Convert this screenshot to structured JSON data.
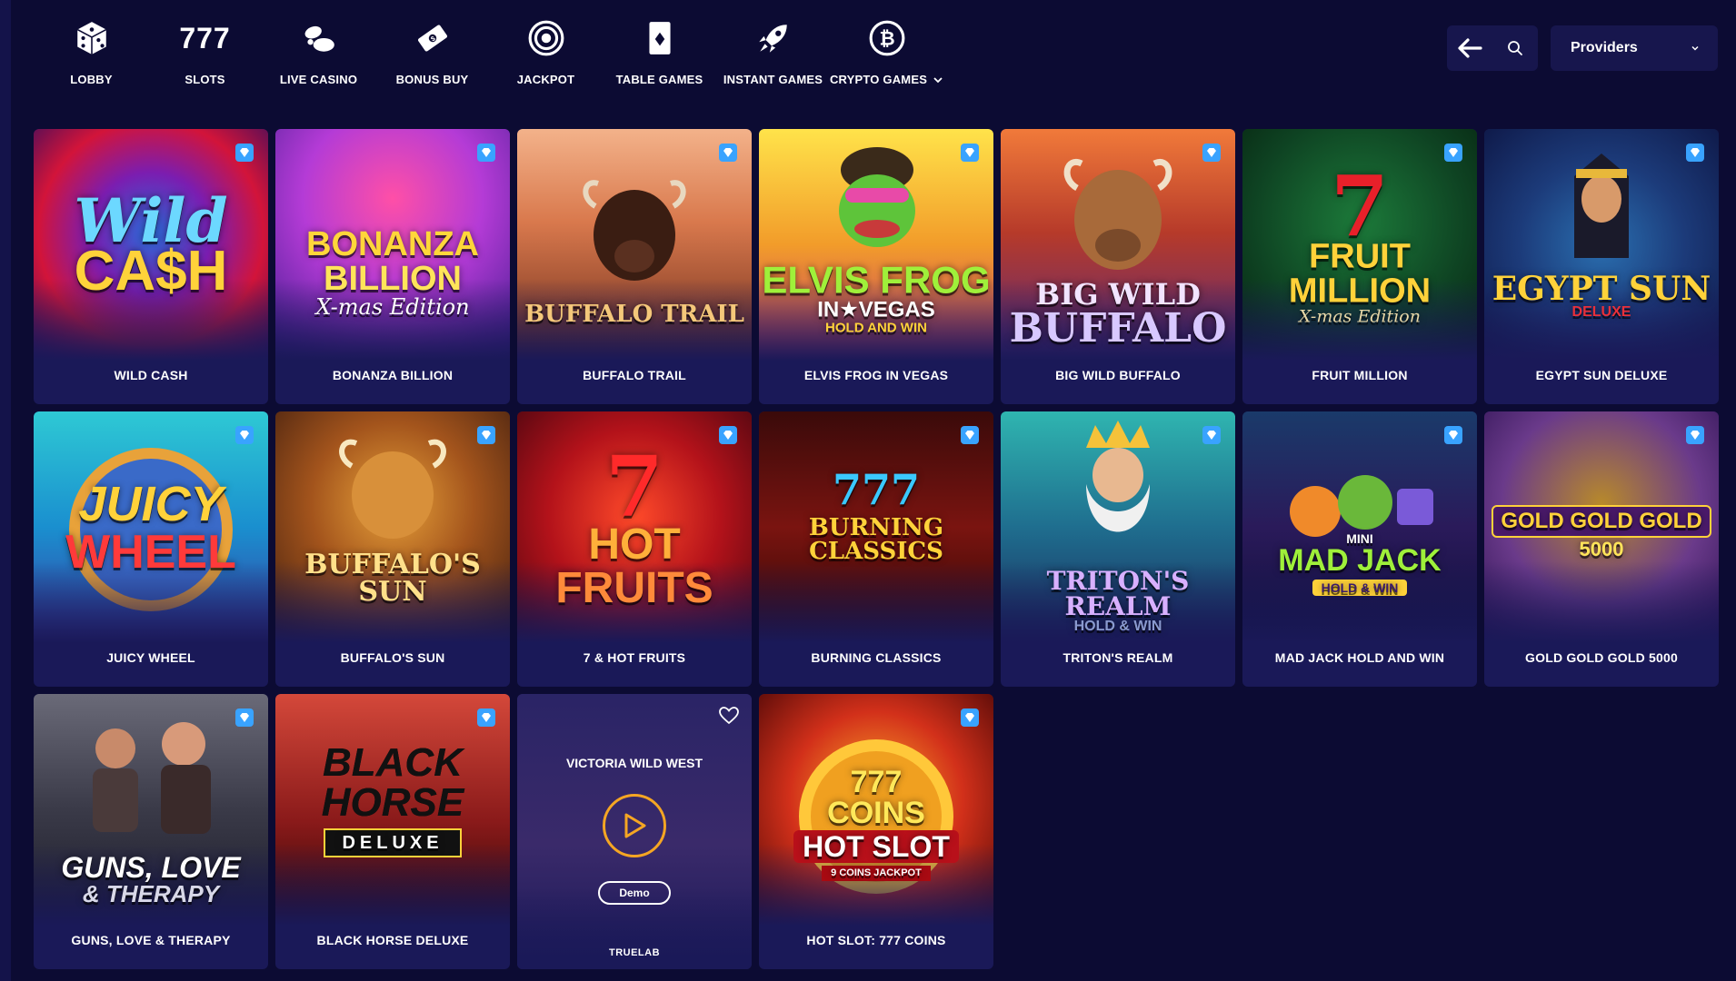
{
  "nav": {
    "items": [
      {
        "label": "LOBBY",
        "icon": "dice-icon"
      },
      {
        "label": "SLOTS",
        "icon": "slots-777-icon",
        "glyph": "777"
      },
      {
        "label": "LIVE CASINO",
        "icon": "live-casino-icon"
      },
      {
        "label": "BONUS BUY",
        "icon": "bonus-buy-icon"
      },
      {
        "label": "JACKPOT",
        "icon": "jackpot-target-icon"
      },
      {
        "label": "TABLE GAMES",
        "icon": "playing-card-icon"
      },
      {
        "label": "INSTANT GAMES",
        "icon": "rocket-icon"
      },
      {
        "label": "CRYPTO GAMES",
        "icon": "bitcoin-icon"
      }
    ]
  },
  "toolbar": {
    "back_icon": "arrow-left-icon",
    "search_icon": "search-icon",
    "providers_label": "Providers"
  },
  "colors": {
    "background": "#0c0b33",
    "card": "#1a1958",
    "badge": "#39a3ff",
    "play_accent": "#f5a623"
  },
  "games": [
    {
      "name": "WILD CASH",
      "logo": [
        "Wild",
        "CA$H"
      ],
      "badge": "diamond-icon"
    },
    {
      "name": "BONANZA BILLION",
      "logo": [
        "BONANZA",
        "BILLION",
        "X-mas Edition"
      ],
      "badge": "diamond-icon"
    },
    {
      "name": "BUFFALO TRAIL",
      "logo": [
        "BUFFALO TRAIL"
      ],
      "badge": "diamond-icon"
    },
    {
      "name": "ELVIS FROG IN VEGAS",
      "logo": [
        "ELVIS FROG",
        "IN★VEGAS",
        "HOLD AND WIN"
      ],
      "badge": "diamond-icon"
    },
    {
      "name": "BIG WILD BUFFALO",
      "logo": [
        "BIG WILD",
        "BUFFALO"
      ],
      "badge": "diamond-icon"
    },
    {
      "name": "FRUIT MILLION",
      "logo": [
        "7",
        "FRUIT",
        "MILLION",
        "X-mas Edition"
      ],
      "badge": "diamond-icon"
    },
    {
      "name": "EGYPT SUN DELUXE",
      "logo": [
        "EGYPT SUN",
        "DELUXE"
      ],
      "badge": "diamond-icon"
    },
    {
      "name": "JUICY WHEEL",
      "logo": [
        "JUICY",
        "WHEEL"
      ],
      "badge": "diamond-icon"
    },
    {
      "name": "BUFFALO'S SUN",
      "logo": [
        "BUFFALO'S",
        "SUN"
      ],
      "badge": "diamond-icon"
    },
    {
      "name": "7 & HOT FRUITS",
      "logo": [
        "7",
        "HOT",
        "FRUITS"
      ],
      "badge": "diamond-icon"
    },
    {
      "name": "BURNING CLASSICS",
      "logo": [
        "777",
        "BURNING CLASSICS"
      ],
      "badge": "diamond-icon"
    },
    {
      "name": "TRITON'S REALM",
      "logo": [
        "TRITON'S REALM",
        "HOLD & WIN"
      ],
      "badge": "diamond-icon"
    },
    {
      "name": "MAD JACK HOLD AND WIN",
      "logo": [
        "MINI",
        "MAD JACK",
        "HOLD & WIN"
      ],
      "badge": "diamond-icon"
    },
    {
      "name": "GOLD GOLD GOLD 5000",
      "logo": [
        "GOLD GOLD GOLD",
        "5000"
      ],
      "badge": "diamond-icon"
    },
    {
      "name": "GUNS, LOVE & THERAPY",
      "logo": [
        "GUNS, LOVE",
        "& THERAPY"
      ],
      "badge": "diamond-icon"
    },
    {
      "name": "BLACK HORSE DELUXE",
      "logo": [
        "BLACK",
        "HORSE",
        "DELUXE"
      ],
      "badge": "diamond-icon"
    },
    {
      "name": "VICTORIA WILD WEST",
      "hover": true,
      "demo_label": "Demo",
      "provider": "TRUELAB"
    },
    {
      "name": "HOT SLOT: 777 COINS",
      "logo": [
        "777",
        "COINS",
        "HOT SLOT",
        "9 COINS JACKPOT"
      ],
      "badge": "diamond-icon"
    }
  ]
}
